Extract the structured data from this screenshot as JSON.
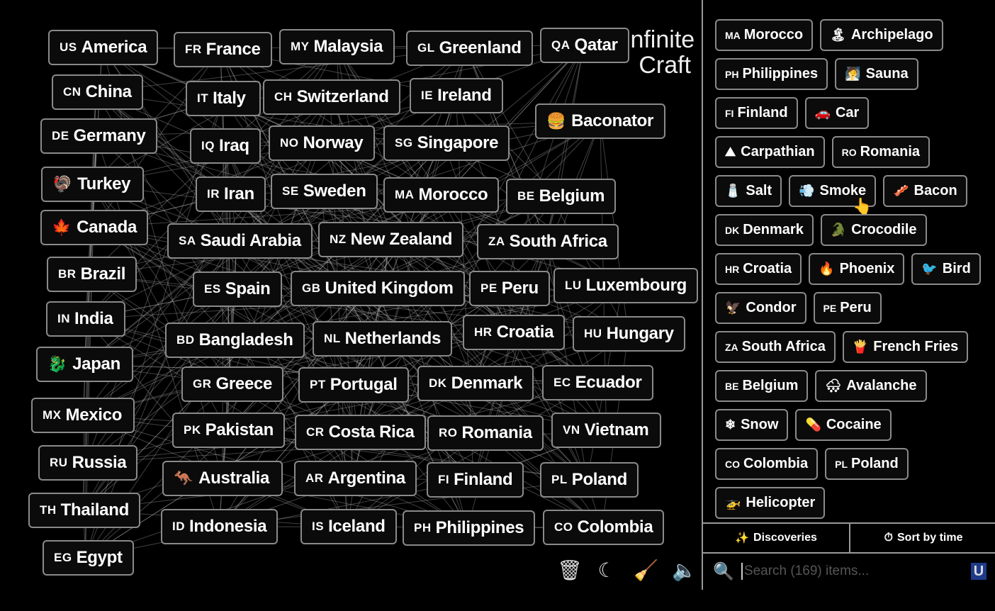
{
  "logo": {
    "line1": "Infinite",
    "line2": "Craft"
  },
  "canvas_items": [
    {
      "code": "US",
      "label": "America"
    },
    {
      "code": "FR",
      "label": "France"
    },
    {
      "code": "MY",
      "label": "Malaysia"
    },
    {
      "code": "GL",
      "label": "Greenland"
    },
    {
      "code": "QA",
      "label": "Qatar"
    },
    {
      "code": "CN",
      "label": "China"
    },
    {
      "code": "IT",
      "label": "Italy"
    },
    {
      "code": "CH",
      "label": "Switzerland"
    },
    {
      "code": "IE",
      "label": "Ireland"
    },
    {
      "emoji": "🍔",
      "label": "Baconator"
    },
    {
      "code": "DE",
      "label": "Germany"
    },
    {
      "code": "IQ",
      "label": "Iraq"
    },
    {
      "code": "NO",
      "label": "Norway"
    },
    {
      "code": "SG",
      "label": "Singapore"
    },
    {
      "emoji": "🦃",
      "label": "Turkey"
    },
    {
      "code": "IR",
      "label": "Iran"
    },
    {
      "code": "SE",
      "label": "Sweden"
    },
    {
      "code": "MA",
      "label": "Morocco"
    },
    {
      "code": "BE",
      "label": "Belgium"
    },
    {
      "emoji": "🍁",
      "label": "Canada"
    },
    {
      "code": "SA",
      "label": "Saudi Arabia"
    },
    {
      "code": "NZ",
      "label": "New Zealand"
    },
    {
      "code": "ZA",
      "label": "South Africa"
    },
    {
      "code": "BR",
      "label": "Brazil"
    },
    {
      "code": "ES",
      "label": "Spain"
    },
    {
      "code": "GB",
      "label": "United Kingdom"
    },
    {
      "code": "PE",
      "label": "Peru"
    },
    {
      "code": "LU",
      "label": "Luxembourg"
    },
    {
      "code": "IN",
      "label": "India"
    },
    {
      "code": "BD",
      "label": "Bangladesh"
    },
    {
      "code": "NL",
      "label": "Netherlands"
    },
    {
      "code": "HR",
      "label": "Croatia"
    },
    {
      "code": "HU",
      "label": "Hungary"
    },
    {
      "emoji": "🐉",
      "label": "Japan"
    },
    {
      "code": "GR",
      "label": "Greece"
    },
    {
      "code": "PT",
      "label": "Portugal"
    },
    {
      "code": "DK",
      "label": "Denmark"
    },
    {
      "code": "EC",
      "label": "Ecuador"
    },
    {
      "code": "MX",
      "label": "Mexico"
    },
    {
      "code": "PK",
      "label": "Pakistan"
    },
    {
      "code": "CR",
      "label": "Costa Rica"
    },
    {
      "code": "RO",
      "label": "Romania"
    },
    {
      "code": "VN",
      "label": "Vietnam"
    },
    {
      "code": "RU",
      "label": "Russia"
    },
    {
      "emoji": "🦘",
      "label": "Australia"
    },
    {
      "code": "AR",
      "label": "Argentina"
    },
    {
      "code": "FI",
      "label": "Finland"
    },
    {
      "code": "PL",
      "label": "Poland"
    },
    {
      "code": "TH",
      "label": "Thailand"
    },
    {
      "code": "ID",
      "label": "Indonesia"
    },
    {
      "code": "IS",
      "label": "Iceland"
    },
    {
      "code": "PH",
      "label": "Philippines"
    },
    {
      "code": "CO",
      "label": "Colombia"
    },
    {
      "code": "EG",
      "label": "Egypt"
    }
  ],
  "toolbar": [
    {
      "icon": "trash-icon",
      "glyph": "🗑"
    },
    {
      "icon": "moon-icon",
      "glyph": "☾"
    },
    {
      "icon": "broom-icon",
      "glyph": "🧹"
    },
    {
      "icon": "sound-icon",
      "glyph": "🔈"
    }
  ],
  "sidebar": {
    "rows": [
      [
        {
          "code": "MA",
          "label": "Morocco"
        },
        {
          "emoji": "🏝",
          "label": "Archipelago"
        }
      ],
      [
        {
          "code": "PH",
          "label": "Philippines"
        },
        {
          "emoji": "🧖",
          "label": "Sauna"
        }
      ],
      [
        {
          "code": "FI",
          "label": "Finland"
        },
        {
          "emoji": "🚗",
          "label": "Car"
        }
      ],
      [
        {
          "emoji": "⛰",
          "label": "Carpathian"
        },
        {
          "code": "RO",
          "label": "Romania"
        }
      ],
      [
        {
          "emoji": "🧂",
          "label": "Salt"
        },
        {
          "emoji": "💨",
          "label": "Smoke"
        },
        {
          "emoji": "🥓",
          "label": "Bacon"
        }
      ],
      [
        {
          "code": "DK",
          "label": "Denmark"
        },
        {
          "emoji": "🐊",
          "label": "Crocodile"
        }
      ],
      [
        {
          "code": "HR",
          "label": "Croatia"
        },
        {
          "emoji": "🔥",
          "label": "Phoenix"
        },
        {
          "emoji": "🐦",
          "label": "Bird"
        }
      ],
      [
        {
          "emoji": "🦅",
          "label": "Condor"
        },
        {
          "code": "PE",
          "label": "Peru"
        }
      ],
      [
        {
          "code": "ZA",
          "label": "South Africa"
        },
        {
          "emoji": "🍟",
          "label": "French Fries"
        }
      ],
      [
        {
          "code": "BE",
          "label": "Belgium"
        },
        {
          "emoji": "🌨",
          "label": "Avalanche"
        }
      ],
      [
        {
          "emoji": "❄",
          "label": "Snow"
        },
        {
          "emoji": "💊",
          "label": "Cocaine"
        }
      ],
      [
        {
          "code": "CO",
          "label": "Colombia"
        },
        {
          "code": "PL",
          "label": "Poland"
        }
      ],
      [
        {
          "emoji": "🚁",
          "label": "Helicopter"
        }
      ],
      [
        {
          "label": ""
        },
        {
          "label": ""
        }
      ]
    ],
    "tabs": {
      "discoveries": "Discoveries",
      "sort": "Sort by time",
      "discoveries_glyph": "✨",
      "sort_glyph": "⏱"
    },
    "search": {
      "placeholder": "Search (169) items...",
      "value": "",
      "glyph": "🔍",
      "badge": "U"
    }
  }
}
